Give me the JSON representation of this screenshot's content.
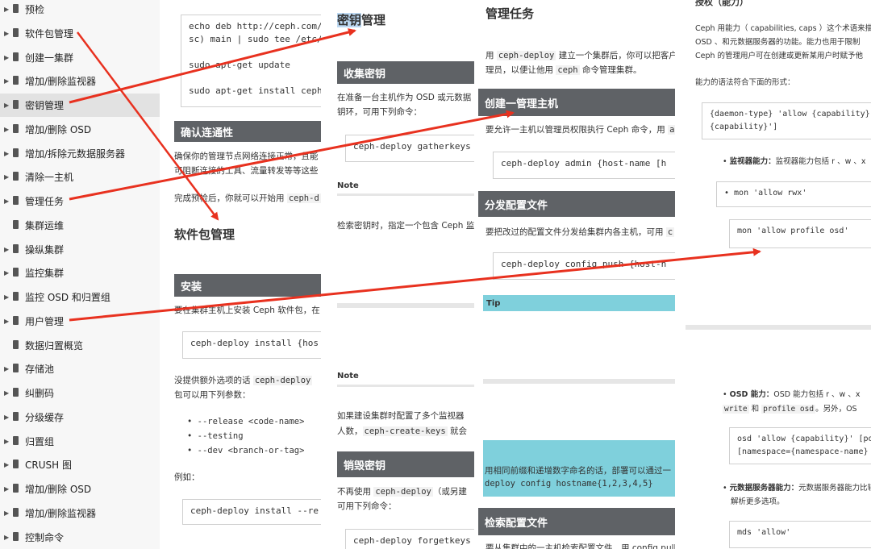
{
  "sidebar": {
    "items": [
      {
        "label": "预检",
        "arrow": "▶"
      },
      {
        "label": "软件包管理",
        "arrow": "▶"
      },
      {
        "label": "创建一集群",
        "arrow": "▶"
      },
      {
        "label": "增加/删除监视器",
        "arrow": "▶"
      },
      {
        "label": "密钥管理",
        "arrow": "▶"
      },
      {
        "label": "增加/删除 OSD",
        "arrow": "▶"
      },
      {
        "label": "增加/拆除元数据服务器",
        "arrow": "▶"
      },
      {
        "label": "清除一主机",
        "arrow": "▶"
      },
      {
        "label": "管理任务",
        "arrow": "▶"
      },
      {
        "label": "集群运维",
        "arrow": ""
      },
      {
        "label": "操纵集群",
        "arrow": "▶"
      },
      {
        "label": "监控集群",
        "arrow": "▶"
      },
      {
        "label": "监控 OSD 和归置组",
        "arrow": "▶"
      },
      {
        "label": "用户管理",
        "arrow": "▶"
      },
      {
        "label": "数据归置概览",
        "arrow": ""
      },
      {
        "label": "存储池",
        "arrow": "▶"
      },
      {
        "label": "纠删码",
        "arrow": "▶"
      },
      {
        "label": "分级缓存",
        "arrow": "▶"
      },
      {
        "label": "归置组",
        "arrow": "▶"
      },
      {
        "label": "CRUSH 图",
        "arrow": "▶"
      },
      {
        "label": "增加/删除 OSD",
        "arrow": "▶"
      },
      {
        "label": "增加/删除监视器",
        "arrow": "▶"
      },
      {
        "label": "控制命令",
        "arrow": "▶"
      }
    ]
  },
  "panel1": {
    "code1": "echo deb http://ceph.com/debian-{ceph-stable-release}/ $(lsb_relea\nsc) main | sudo tee /etc/apt/sources.list.d/ceph.list\n\nsudo apt-get update\n\nsudo apt-get install ceph-deploy",
    "heading_confirm": "确认连通性",
    "confirm_line1": "确保你的管理节点网络连接正常，且能",
    "confirm_line2": "可阻断连接的工具、流量转发等等这些",
    "finish_prefix": "完成预检后，你就可以开始用 ",
    "finish_code": "ceph-d",
    "title_pkg": "软件包管理",
    "heading_install": "安装",
    "install_line": "要在集群主机上安装 Ceph 软件包，在",
    "code_install": "ceph-deploy install {hos",
    "opts_prefix": "没提供额外选项的话 ",
    "opts_code": "ceph-deploy",
    "opts_line2": "包可以用下列参数：",
    "bullets": [
      "--release <code-name>",
      "--testing",
      "--dev <branch-or-tag>"
    ],
    "example_label": "例如：",
    "code_example": "ceph-deploy install --re"
  },
  "panel2": {
    "title_hl": "密钥",
    "title_rest": "管理",
    "heading_collect": "收集密钥",
    "collect_line1": "在准备一台主机作为 OSD 或元数据",
    "collect_line2": "钥环，可用下列命令：",
    "code_collect": "ceph-deploy gatherkeys",
    "note1": "Note",
    "note1_text": "检索密钥时，指定一个包含 Ceph 监",
    "note2": "Note",
    "note2_line1": "如果建设集群时配置了多个监视器",
    "note2_line2_prefix": "人数，",
    "note2_code": "ceph-create-keys",
    "note2_line2_suffix": " 就会",
    "heading_destroy": "销毁密钥",
    "destroy_prefix": "不再使用 ",
    "destroy_code": "ceph-deploy",
    "destroy_suffix": "（或另建",
    "destroy_line2": "可用下列命令：",
    "code_destroy": "ceph-deploy forgetkeys"
  },
  "panel3": {
    "title": "管理任务",
    "intro1_prefix": "用 ",
    "intro1_code": "ceph-deploy",
    "intro1_suffix": " 建立一个集群后，你可以把客户",
    "intro2_prefix": "理员，以便让他用 ",
    "intro2_code": "ceph",
    "intro2_suffix": " 命令管理集群。",
    "heading_admin": "创建一管理主机",
    "admin_line_prefix": "要允许一主机以管理员权限执行 Ceph 命令，用 ",
    "admin_line_code": "ad",
    "code_admin": "ceph-deploy admin {host-name [h",
    "heading_distribute": "分发配置文件",
    "distribute_line_prefix": "要把改过的配置文件分发给集群内各主机，可用 ",
    "distribute_line_code": "c",
    "code_distribute": "ceph-deploy config push {host-n",
    "tip": "Tip",
    "tip_line1": "用相同前缀和递增数字命名的话，部署可以通过一",
    "tip_line2": "deploy config hostname{1,2,3,4,5}",
    "heading_retrieve": "检索配置文件",
    "retrieve_line": "要从集群中的一主机检索配置文件，用 config pull"
  },
  "panel4": {
    "title": "授权（能力）",
    "line1": "Ceph 用能力（ capabilities, caps ）这个术语来描",
    "line2": "OSD 、和元数据服务器的功能。能力也用于限制",
    "line3": "Ceph 的管理用户可在创建或更新某用户时赋予他",
    "syntax_line": "能力的语法符合下面的形式：",
    "code_syntax": "{daemon-type} 'allow {capability}\n{capability}']",
    "mon_bullet_bold": "监视器能力：",
    "mon_bullet_rest": "监视器能力包括 r 、w 、x",
    "code_mon1": "• mon 'allow rwx'",
    "code_mon2": "mon 'allow profile osd'",
    "osd_bullet_bold": "OSD 能力：",
    "osd_bullet_rest": "OSD 能力包括 r 、w 、x",
    "osd_line2_code1": "write",
    "osd_line2_mid": " 和 ",
    "osd_line2_code2": "profile osd",
    "osd_line2_suffix": "。另外，OS",
    "code_osd": "osd 'allow {capability}' [po\n[namespace={namespace-name}",
    "mds_bullet_bold": "元数据服务器能力：",
    "mds_bullet_rest": "元数据服务器能力比较",
    "mds_line2": "解析更多选项。",
    "code_mds": "mds 'allow'"
  },
  "colors": {
    "arrow": "#e8311f",
    "header_bar": "#5f6266",
    "tip": "#7fd0dc",
    "highlight": "#bcd8f2"
  }
}
